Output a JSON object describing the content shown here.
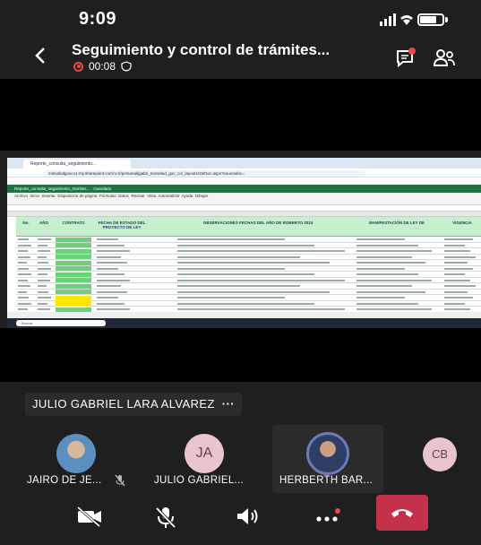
{
  "status_bar": {
    "time": "9:09"
  },
  "header": {
    "title": "Seguimiento y control de trámites...",
    "recording_time": "00:08"
  },
  "shared_screen": {
    "browser_tab": "Reporte_consulta_seguimiento...",
    "url": "minsaludgovco1-my.sharepoint.com/:x:/r/personal/jgabri_minsalud_gov_co/_layouts/15/Doc.aspx?sourcedoc=",
    "excel_app_bar": "Reporte_consulta_seguimiento_tramites... · Guardado",
    "ribbon_items": [
      "Archivo",
      "Inicio",
      "Insertar",
      "Disposición de página",
      "Fórmulas",
      "Datos",
      "Revisar",
      "Vista",
      "Automatizar",
      "Ayuda",
      "Dibujar"
    ],
    "column_headers": [
      "No.",
      "AÑO",
      "CONTRATO",
      "FECHA DE ESTADO DEL PROYECTO DE LEY",
      "OBSERVACIONES FECHAS DEL AÑO DE ROBERTO 2024",
      "MANIFESTACIÓN DE LEY DE",
      "VIGENCIA"
    ],
    "taskbar_search": "Buscar"
  },
  "active_speaker": {
    "name": "JULIO GABRIEL LARA ALVAREZ",
    "more": "···"
  },
  "participants": [
    {
      "name": "JAIRO DE JE...",
      "initials": "",
      "muted": true
    },
    {
      "name": "JULIO GABRIEL...",
      "initials": "JA",
      "muted": false
    },
    {
      "name": "HERBERTH BAR...",
      "initials": "",
      "muted": false
    },
    {
      "name": "",
      "initials": "CB",
      "muted": false
    }
  ],
  "controls": {
    "camera": "camera-off-icon",
    "mic": "mic-off-icon",
    "speaker": "speaker-icon",
    "more": "more-icon",
    "leave": "hang-up-icon"
  },
  "colors": {
    "leave": "#c4314b",
    "recording": "#e84a4a",
    "initials_bg": "#e9c6cc"
  }
}
